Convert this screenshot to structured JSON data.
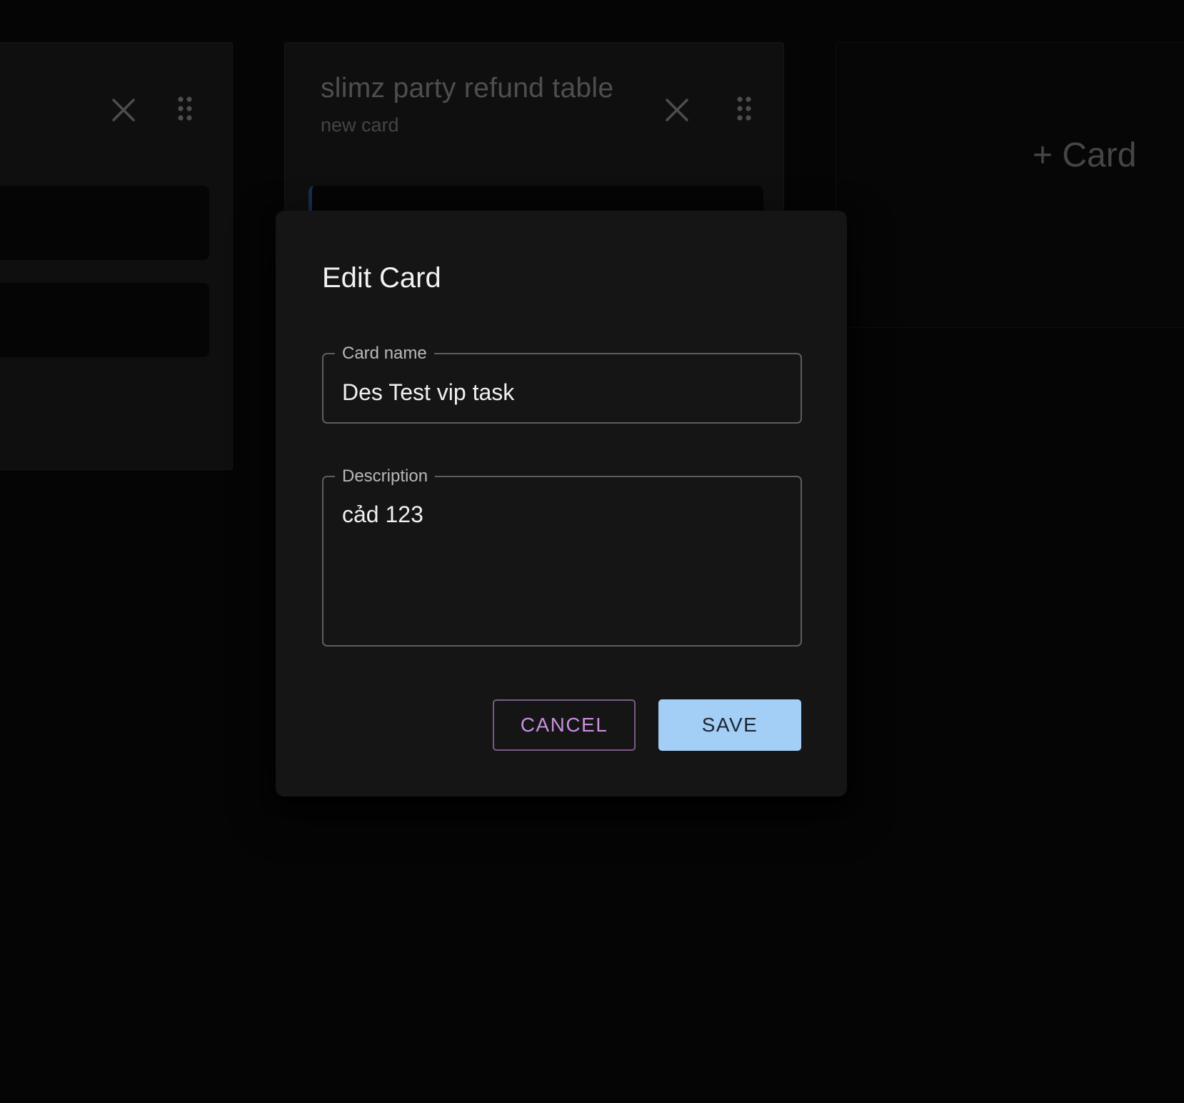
{
  "board": {
    "columns": [
      {
        "title": "",
        "subtitle": "",
        "close_icon": "close-icon",
        "drag_icon": "drag-handle-icon"
      },
      {
        "title": "slimz party refund table",
        "subtitle": "new card",
        "close_icon": "close-icon",
        "drag_icon": "drag-handle-icon"
      }
    ],
    "add_card_label": "+ Card"
  },
  "dialog": {
    "title": "Edit Card",
    "card_name": {
      "label": "Card name",
      "value": "Des Test vip task"
    },
    "description": {
      "label": "Description",
      "value": "cảd 123"
    },
    "cancel_label": "CANCEL",
    "save_label": "SAVE"
  },
  "colors": {
    "background": "#0b0b0c",
    "dialog": "#151516",
    "cancel_text": "#c890db",
    "save_bg": "#a3cff7"
  }
}
